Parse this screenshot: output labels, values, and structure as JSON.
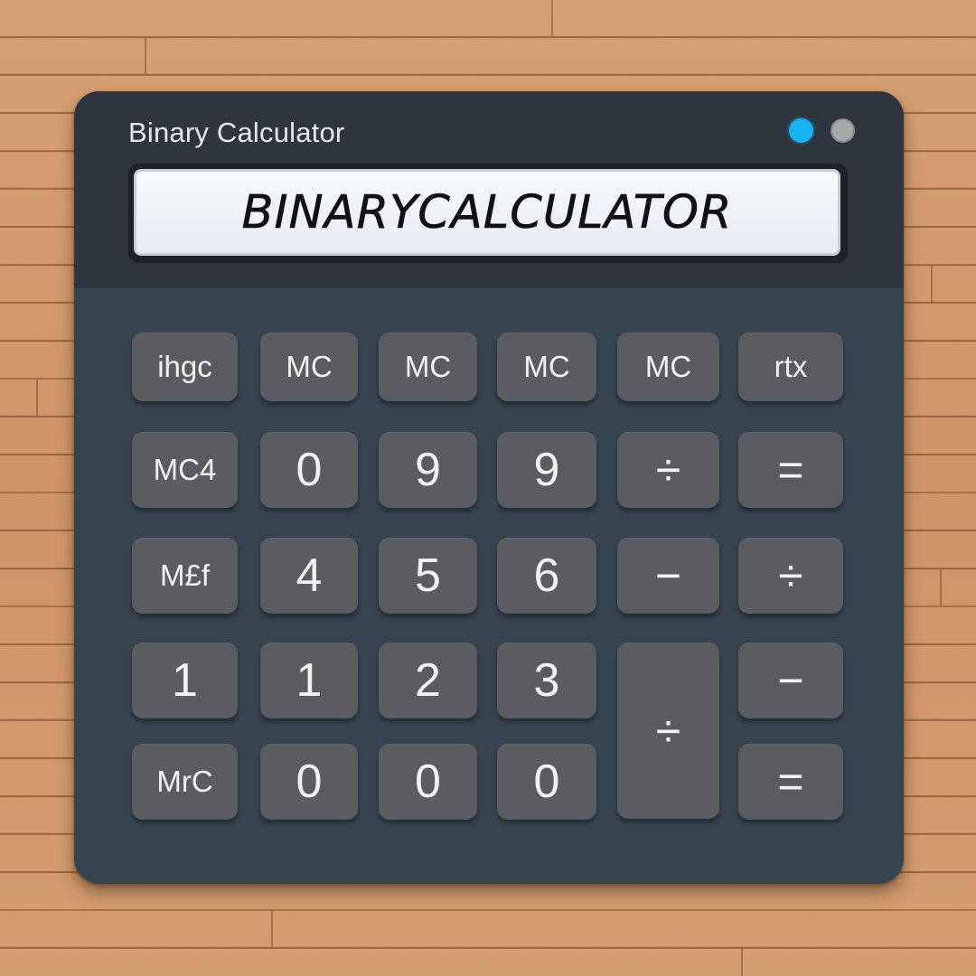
{
  "window": {
    "title": "Binary Calculator"
  },
  "display": {
    "value": "BINARYCALCULATOR"
  },
  "colors": {
    "body": "#36444f",
    "header": "#2f353e",
    "key": "#5a5c60",
    "indicator_active": "#19b4f0",
    "indicator_inactive": "#a7a8aa",
    "background_wood": "#d19a6d"
  },
  "keys": {
    "r1c1": "ihgc",
    "r1c2": "MC",
    "r1c3": "MC",
    "r1c4": "MC",
    "r1c5": "MC",
    "r1c6": "rtx",
    "r2c1": "MC4",
    "r2c2": "0",
    "r2c3": "9",
    "r2c4": "9",
    "r2c5": "÷",
    "r2c6": "=",
    "r3c1": "M£f",
    "r3c2": "4",
    "r3c3": "5",
    "r3c4": "6",
    "r3c5": "−",
    "r3c6": "÷",
    "r4c1": "1",
    "r4c2": "1",
    "r4c3": "2",
    "r4c4": "3",
    "r45c5": "÷",
    "r4c6": "−",
    "r5c1": "MrC",
    "r5c2": "0",
    "r5c3": "0",
    "r5c4": "0",
    "r5c6": "="
  }
}
